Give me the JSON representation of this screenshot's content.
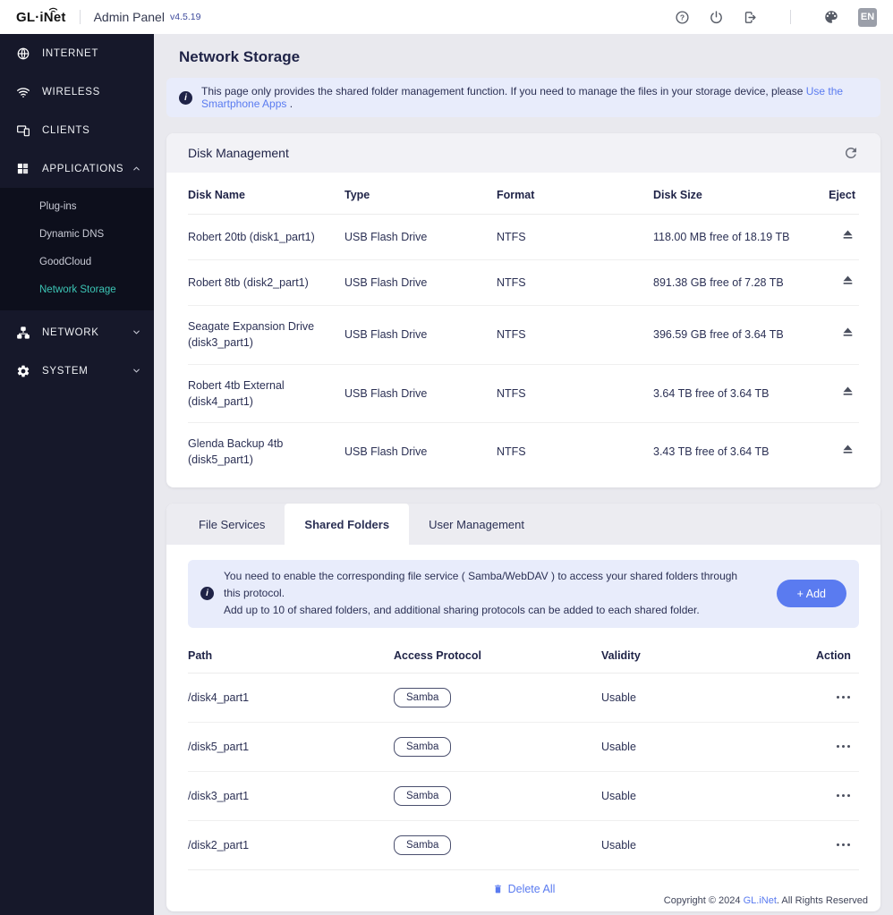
{
  "topbar": {
    "logo_text": "GL·iNet",
    "app_title": "Admin Panel",
    "version": "v4.5.19",
    "language_badge": "EN"
  },
  "sidebar": {
    "items": [
      {
        "label": "INTERNET",
        "icon": "globe-icon"
      },
      {
        "label": "WIRELESS",
        "icon": "wifi-icon"
      },
      {
        "label": "CLIENTS",
        "icon": "clients-icon"
      },
      {
        "label": "APPLICATIONS",
        "icon": "apps-grid-icon",
        "expanded": true
      },
      {
        "label": "NETWORK",
        "icon": "network-icon",
        "expanded": false
      },
      {
        "label": "SYSTEM",
        "icon": "gear-icon",
        "expanded": false
      }
    ],
    "applications_submenu": [
      {
        "label": "Plug-ins"
      },
      {
        "label": "Dynamic DNS"
      },
      {
        "label": "GoodCloud"
      },
      {
        "label": "Network Storage"
      }
    ],
    "active_item": "Network Storage"
  },
  "page": {
    "title": "Network Storage",
    "banner_text": "This page only provides the shared folder management function. If you need to manage the files in your storage device, please ",
    "banner_link": "Use the Smartphone Apps",
    "banner_suffix": " ."
  },
  "disk_management": {
    "title": "Disk Management",
    "columns": {
      "name": "Disk Name",
      "type": "Type",
      "format": "Format",
      "size": "Disk Size",
      "eject": "Eject"
    },
    "rows": [
      {
        "name": "Robert 20tb (disk1_part1)",
        "type": "USB Flash Drive",
        "format": "NTFS",
        "size": "118.00 MB free of 18.19 TB"
      },
      {
        "name": "Robert 8tb (disk2_part1)",
        "type": "USB Flash Drive",
        "format": "NTFS",
        "size": "891.38 GB free of 7.28 TB"
      },
      {
        "name": "Seagate Expansion Drive (disk3_part1)",
        "type": "USB Flash Drive",
        "format": "NTFS",
        "size": "396.59 GB free of 3.64 TB"
      },
      {
        "name": "Robert 4tb External (disk4_part1)",
        "type": "USB Flash Drive",
        "format": "NTFS",
        "size": "3.64 TB free of 3.64 TB"
      },
      {
        "name": "Glenda Backup 4tb (disk5_part1)",
        "type": "USB Flash Drive",
        "format": "NTFS",
        "size": "3.43 TB free of 3.64 TB"
      }
    ]
  },
  "shared_folders": {
    "tabs": [
      {
        "label": "File Services"
      },
      {
        "label": "Shared Folders"
      },
      {
        "label": "User Management"
      }
    ],
    "active_tab": "Shared Folders",
    "notice_line1": "You need to enable the corresponding file service ( Samba/WebDAV ) to access your shared folders through this protocol.",
    "notice_line2": "Add up to 10 of shared folders, and additional sharing protocols can be added to each shared folder.",
    "add_button": "+ Add",
    "columns": {
      "path": "Path",
      "protocol": "Access Protocol",
      "validity": "Validity",
      "action": "Action"
    },
    "rows": [
      {
        "path": "/disk4_part1",
        "protocol": "Samba",
        "validity": "Usable"
      },
      {
        "path": "/disk5_part1",
        "protocol": "Samba",
        "validity": "Usable"
      },
      {
        "path": "/disk3_part1",
        "protocol": "Samba",
        "validity": "Usable"
      },
      {
        "path": "/disk2_part1",
        "protocol": "Samba",
        "validity": "Usable"
      }
    ],
    "delete_all": "Delete All"
  },
  "footer": {
    "prefix": "Copyright © 2024 ",
    "link": "GL.iNet",
    "suffix": ". All Rights Reserved"
  },
  "colors": {
    "accent_blue": "#5a7bf0",
    "accent_teal": "#3cc5b5",
    "sidebar_bg": "#16182a",
    "sidebar_submenu_bg": "#0d0f1c",
    "banner_bg": "#e8ecfb",
    "page_bg": "#e9e9ee",
    "card_header_bg": "#f2f2f6",
    "text_navy": "#1f2347"
  },
  "icons": {
    "topbar": [
      "help-icon",
      "power-icon",
      "logout-icon",
      "palette-icon"
    ],
    "sidebar": [
      "globe-icon",
      "wifi-icon",
      "clients-icon",
      "apps-grid-icon",
      "network-icon",
      "gear-icon",
      "chevron-up-icon",
      "chevron-down-icon"
    ],
    "content": [
      "info-icon",
      "refresh-icon",
      "eject-icon",
      "more-actions-icon",
      "trash-icon"
    ]
  }
}
